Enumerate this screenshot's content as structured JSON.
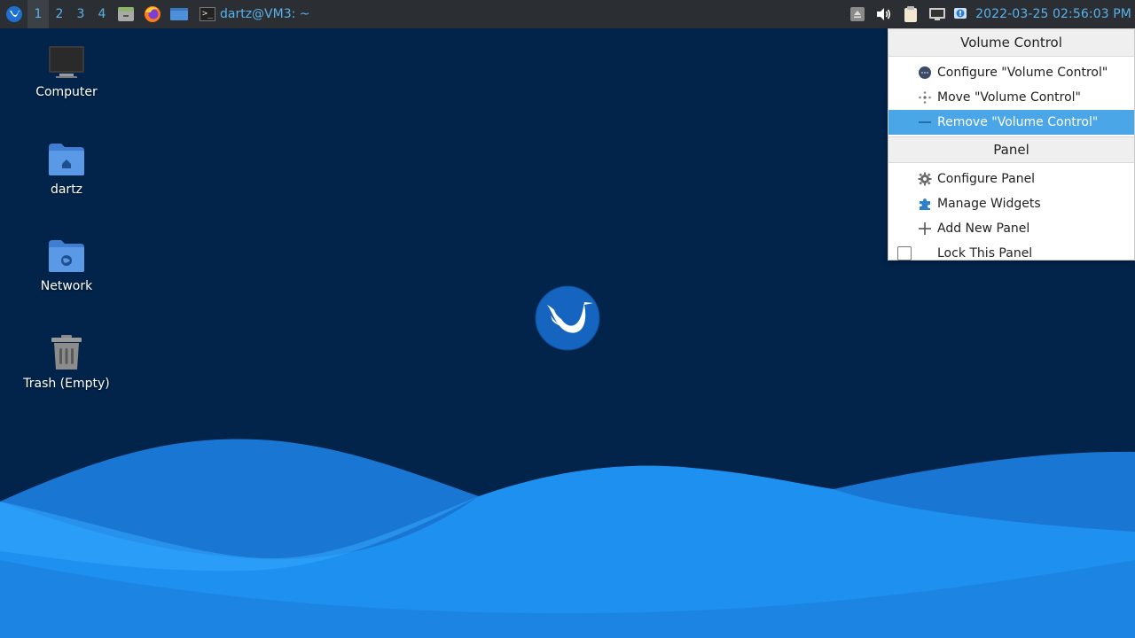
{
  "panel": {
    "workspaces": [
      "1",
      "2",
      "3",
      "4"
    ],
    "active_workspace": "1",
    "task": {
      "label": "dartz@VM3: ~"
    },
    "clock": "2022-03-25 02:56:03 PM",
    "accent_color": "#5ab1ea"
  },
  "desktop": {
    "icons": [
      {
        "label": "Computer",
        "icon": "computer-icon"
      },
      {
        "label": "dartz",
        "icon": "home-folder-icon"
      },
      {
        "label": "Network",
        "icon": "network-folder-icon"
      },
      {
        "label": "Trash (Empty)",
        "icon": "trash-icon"
      }
    ]
  },
  "context_menu": {
    "volume_header": "Volume Control",
    "volume_items": [
      {
        "label": "Configure \"Volume Control\"",
        "icon": "configure-icon"
      },
      {
        "label": "Move \"Volume Control\"",
        "icon": "move-icon"
      },
      {
        "label": "Remove \"Volume Control\"",
        "icon": "remove-icon",
        "highlighted": true
      }
    ],
    "panel_header": "Panel",
    "panel_items": [
      {
        "label": "Configure Panel",
        "icon": "gear-icon"
      },
      {
        "label": "Manage Widgets",
        "icon": "puzzle-icon"
      },
      {
        "label": "Add New Panel",
        "icon": "plus-icon"
      },
      {
        "label": "Lock This Panel",
        "icon": "checkbox",
        "checked": false
      }
    ],
    "highlight_color": "#4aa6e6"
  }
}
